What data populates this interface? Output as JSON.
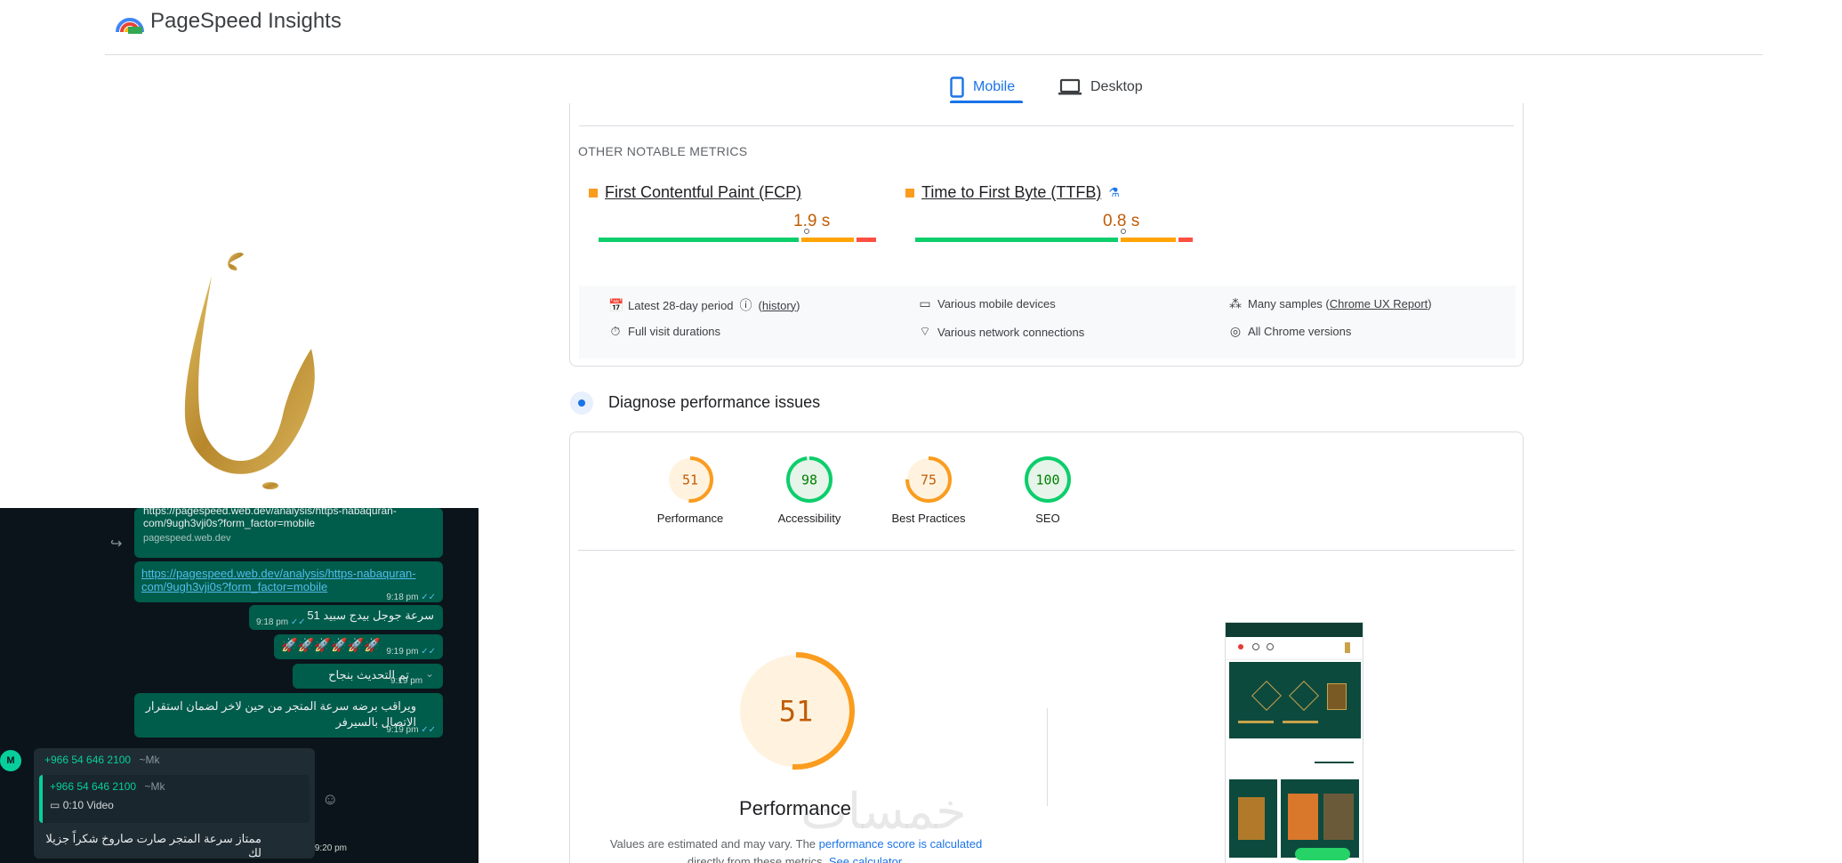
{
  "app": {
    "title": "PageSpeed Insights"
  },
  "tabs": [
    {
      "label": "Mobile",
      "icon": "smartphone-icon",
      "active": true
    },
    {
      "label": "Desktop",
      "icon": "laptop-icon",
      "active": false
    }
  ],
  "metrics_section": {
    "label": "OTHER NOTABLE METRICS",
    "metrics": [
      {
        "name": "First Contentful Paint (FCP)",
        "value": "1.9 s",
        "status_color": "#fa9c1e",
        "distribution": {
          "good": 0.73,
          "needs_improvement": 0.2,
          "poor": 0.07
        },
        "marker_fraction": 0.75
      },
      {
        "name": "Time to First Byte (TTFB)",
        "value": "0.8 s",
        "status_color": "#fa9c1e",
        "experimental_icon": "flask-icon",
        "distribution": {
          "good": 0.74,
          "needs_improvement": 0.21,
          "poor": 0.05
        },
        "marker_fraction": 0.75
      }
    ],
    "info": {
      "period": "Latest 28-day period",
      "history_link": "history",
      "devices": "Various mobile devices",
      "samples_prefix": "Many samples (",
      "samples_link": "Chrome UX Report",
      "samples_suffix": ")",
      "durations": "Full visit durations",
      "network": "Various network connections",
      "versions": "All Chrome versions"
    }
  },
  "diagnose": {
    "title": "Diagnose performance issues",
    "scores": [
      {
        "label": "Performance",
        "value": "51",
        "color": "#fa9c1e",
        "text_color": "#c05c05",
        "bg": "#fff3e0"
      },
      {
        "label": "Accessibility",
        "value": "98",
        "color": "#0cce6b",
        "text_color": "#008000",
        "bg": "#e6f4ea"
      },
      {
        "label": "Best Practices",
        "value": "75",
        "color": "#fa9c1e",
        "text_color": "#c05c05",
        "bg": "#fff3e0"
      },
      {
        "label": "SEO",
        "value": "100",
        "color": "#0cce6b",
        "text_color": "#008000",
        "bg": "#e6f4ea"
      }
    ],
    "main_score": {
      "value": "51",
      "label": "Performance"
    },
    "note": {
      "prefix": "Values are estimated and may vary. The ",
      "link1": "performance score is calculated",
      "middle": "directly from these metrics. ",
      "link2": "See calculator."
    }
  },
  "whatsapp": {
    "top_preview_line1": "https://pagespeed.web.dev/analysis/https-nabaquran-",
    "top_preview_line2": "com/9ugh3vji0s?form_factor=mobile",
    "top_preview_domain": "pagespeed.web.dev",
    "link_line1": "https://pagespeed.web.dev/analysis/https-nabaquran-",
    "link_line2": "com/9ugh3vji0s?form_factor=mobile",
    "link_time": "9:18 pm",
    "messages": [
      {
        "text": "سرعة جوجل بيدج سبيد 51",
        "time": "9:18 pm"
      },
      {
        "text": "🚀🚀🚀🚀🚀🚀",
        "time": "9:19 pm"
      },
      {
        "text": "تم التحديث بنجاح",
        "time": "9:19 pm"
      },
      {
        "text": "ويراقب برضه سرعة المتجر من حين لاخر لضمان استقرار الاتصال بالسيرفر",
        "time": "9:19 pm"
      }
    ],
    "incoming": {
      "avatar": "M",
      "sender": "+966 54 646 2100",
      "sender_name": "~Mk",
      "quoted_sender": "+966 54 646 2100",
      "quoted_name": "~Mk",
      "quoted_media": "0:10 Video",
      "text": "ممتاز سرعة المتجر صارت صاروخ شكراً جزيلا لك",
      "time": "9:20 pm"
    }
  },
  "watermark": "خمسات"
}
